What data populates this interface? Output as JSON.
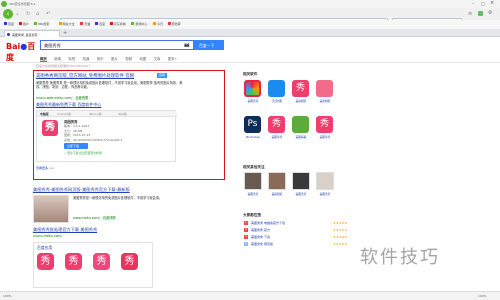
{
  "browser": {
    "title": "360安全浏览器 8.1",
    "url": "https://www.baidu.com/s?wd=美图秀秀&ie=utf-8&tn=baidu",
    "search_placeholder": "点此搜索",
    "bookmarks": [
      "百度",
      "用户",
      "360搜索",
      "网址大全",
      "天猫",
      "百度",
      "京东商城",
      "游戏中心",
      "今日",
      "聚划算"
    ],
    "tab_label": "美图秀秀_百度搜索"
  },
  "baidu": {
    "query": "美图秀秀",
    "search_button": "百度一下",
    "tabs": [
      "网页",
      "新闻",
      "贴吧",
      "知道",
      "音乐",
      "图片",
      "视频",
      "地图",
      "文库",
      "更多»"
    ],
    "result_count": "百度为您找到相关结果约100,000,000个"
  },
  "result_main": {
    "title": "美图秀秀网页版_官方网站_免费图片处理软件 官网",
    "desc": "美图秀秀 美图秀秀 是一款很好用的免费图片处理软件，不用学习就会用。美图秀秀 独有的图片特效、美容、拼图、场景、边框、饰品等功能。",
    "url": "xiuxiu.web.meitu.com/ - 百度快照",
    "sub_link": "美图秀秀最新免费下载 百度软件中心"
  },
  "card": {
    "tabs": [
      "电脑版",
      "Android版",
      "iPhone版",
      "iPad版"
    ],
    "app_name": "美图秀秀",
    "version": "版本：4.0.1.2002",
    "size": "大小：28.4M",
    "date": "更新：2015-07-23",
    "system": "系统：Win2000/WinXP/Win7/Vista/Win7",
    "download": "立即下载",
    "safe": "✓ 安全下载 经过百度安全检测"
  },
  "result_2": {
    "title": "美图秀秀-美图秀秀网页版-美图秀秀官方下载-最新版",
    "desc": "美图秀秀是一款很好用的免费图片处理软件，不用学习就会用。",
    "url": "www.meitu.com/ - 百度快照"
  },
  "result_3": {
    "title": "美图秀秀批处理官方下载 美图秀秀",
    "url": "xiuxiu.meitu.com/"
  },
  "result_4": {
    "title": "百度应用"
  },
  "right": {
    "section1_title": "相关软件",
    "section2_title": "相关其他关注",
    "section3_title": "大家都在搜",
    "apps1": [
      "美图秀秀",
      "天天P图",
      "美颜相机",
      "美妆相机",
      "Photoshop",
      "美图秀秀",
      "美图看看",
      "美图秀秀"
    ],
    "apps2": [
      "美图秀秀",
      "美颜相机",
      "美图秀秀",
      "美图秀秀"
    ],
    "hot": [
      "美图秀秀 电脑版官方下载",
      "美图秀秀 官方",
      "美图秀秀 下载",
      "美图秀秀 网页版"
    ]
  },
  "watermark": "软件技巧",
  "status": {
    "left": "100%",
    "right": "100%"
  }
}
